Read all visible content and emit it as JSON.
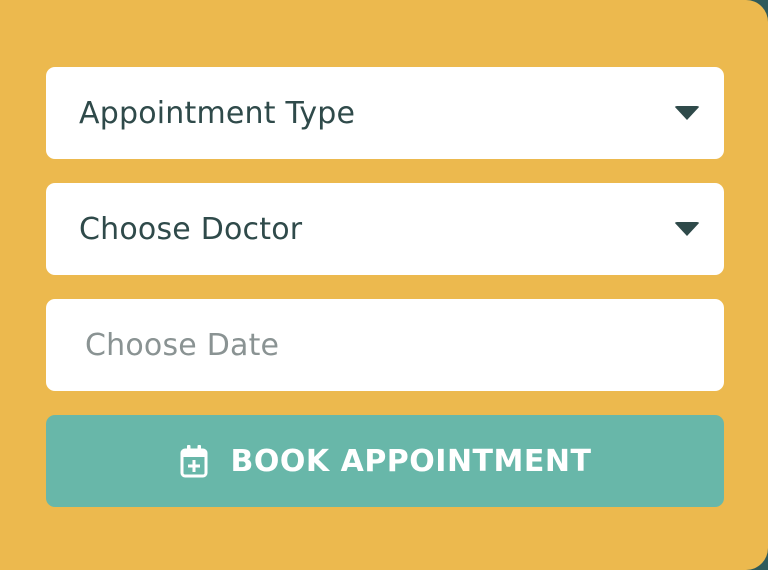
{
  "form": {
    "appointment_type": {
      "label": "Appointment Type"
    },
    "doctor": {
      "label": "Choose Doctor"
    },
    "date": {
      "placeholder": "Choose Date",
      "value": ""
    },
    "book_button": {
      "label": "BOOK APPOINTMENT",
      "icon": "calendar-plus-icon"
    }
  },
  "colors": {
    "background": "#ecb94e",
    "field_background": "#ffffff",
    "text": "#2f4a4a",
    "placeholder": "#8a9393",
    "button": "#68b7a9",
    "button_text": "#ffffff"
  }
}
